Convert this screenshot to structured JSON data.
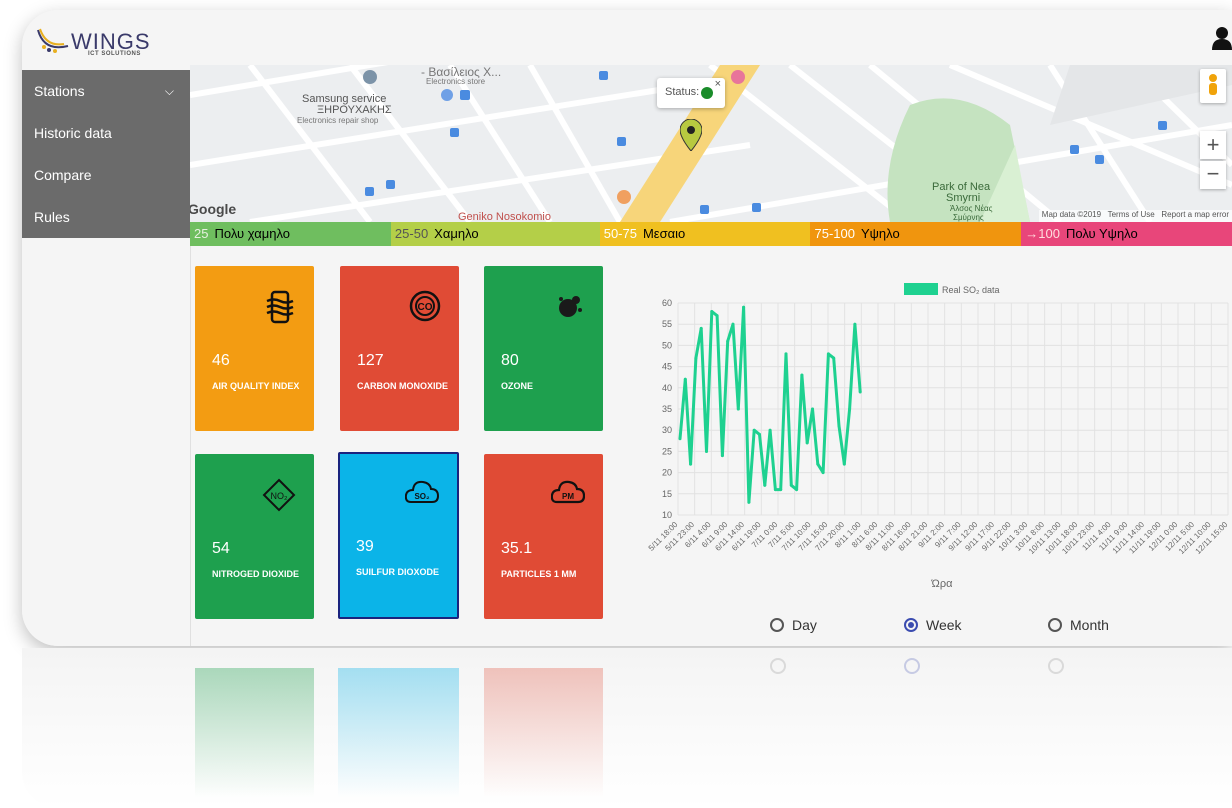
{
  "header": {
    "logo_text": "WINGS",
    "logo_sub": "ICT SOLUTIONS"
  },
  "sidebar": {
    "items": [
      {
        "label": "Stations"
      },
      {
        "label": "Historic data"
      },
      {
        "label": "Compare"
      },
      {
        "label": "Rules"
      }
    ]
  },
  "map": {
    "places": [
      "Samsung service",
      "ΞΗΡΟΥΧΑΚΗΣ",
      "Electronics repair shop",
      "- Βασίλειος Χ...",
      "Electronics store",
      "Park of Nea",
      "Smyrni",
      "Άλσος Νέας",
      "Σμύρνης",
      "Geniko Nosokomio",
      "Google"
    ],
    "popup_label": "Status:",
    "footer": [
      "Map data ©2019",
      "Terms of Use",
      "Report a map error"
    ]
  },
  "legend": [
    {
      "range": "25",
      "label": "Πολυ χαμηλο",
      "color": "#6fbe5f"
    },
    {
      "range": "25-50",
      "label": "Χαμηλο",
      "color": "#b4cf48"
    },
    {
      "range": "50-75",
      "label": "Μεσαιο",
      "color": "#f0c020"
    },
    {
      "range": "75-100",
      "label": "Υψηλο",
      "color": "#f0950e"
    },
    {
      "range": "→100",
      "label": "Πολυ Υψηλο",
      "color": "#e8467a"
    }
  ],
  "cards": [
    {
      "value": "46",
      "label": "AIR QUALITY INDEX",
      "color": "#f39c12",
      "icon": "air-icon"
    },
    {
      "value": "127",
      "label": "CARBON MONOXIDE",
      "color": "#e04b35",
      "icon": "co-icon"
    },
    {
      "value": "80",
      "label": "OZONE",
      "color": "#1ea04e",
      "icon": "ozone-icon"
    },
    {
      "value": "54",
      "label": "NITROGED DIOXIDE",
      "color": "#1ea04e",
      "icon": "no2-icon"
    },
    {
      "value": "39",
      "label": "SUILFUR DIOXODE",
      "color": "#0bb4e8",
      "icon": "so2-icon"
    },
    {
      "value": "35.1",
      "label": "PARTICLES 1 MM",
      "color": "#e04b35",
      "icon": "pm-icon"
    }
  ],
  "radios": [
    {
      "label": "Day",
      "checked": false
    },
    {
      "label": "Week",
      "checked": true
    },
    {
      "label": "Month",
      "checked": false
    }
  ],
  "chart_data": {
    "type": "line",
    "series": [
      {
        "name": "Real SO₂ data",
        "color": "#1ed190",
        "values": [
          28,
          42,
          22,
          47,
          54,
          25,
          58,
          57,
          24,
          51,
          55,
          35,
          59,
          13,
          30,
          29,
          17,
          30,
          16,
          16,
          48,
          17,
          16,
          43,
          27,
          35,
          22,
          20,
          48,
          47,
          31,
          22,
          35,
          55,
          39
        ]
      }
    ],
    "x": [
      "5/11 18:00",
      "5/11 23:00",
      "6/11 4:00",
      "6/11 9:00",
      "6/11 14:00",
      "6/11 19:00",
      "7/11 0:00",
      "7/11 5:00",
      "7/11 10:00",
      "7/11 15:00",
      "7/11 20:00",
      "8/11 1:00",
      "8/11 6:00",
      "8/11 11:00",
      "8/11 16:00",
      "8/11 21:00",
      "9/11 2:00",
      "9/11 7:00",
      "9/11 12:00",
      "9/11 17:00",
      "9/11 22:00",
      "10/11 3:00",
      "10/11 8:00",
      "10/11 13:00",
      "10/11 18:00",
      "10/11 23:00",
      "11/11 4:00",
      "11/11 9:00",
      "11/11 14:00",
      "11/11 19:00",
      "12/11 0:00",
      "12/11 5:00",
      "12/11 10:00",
      "12/11 15:00"
    ],
    "xlabel": "Ώρα",
    "yticks": [
      "60",
      "55",
      "50",
      "45",
      "40",
      "35",
      "30",
      "25",
      "20",
      "15",
      "10"
    ],
    "ylim": [
      10,
      60
    ],
    "grid": true,
    "legend_position": "top-center"
  }
}
